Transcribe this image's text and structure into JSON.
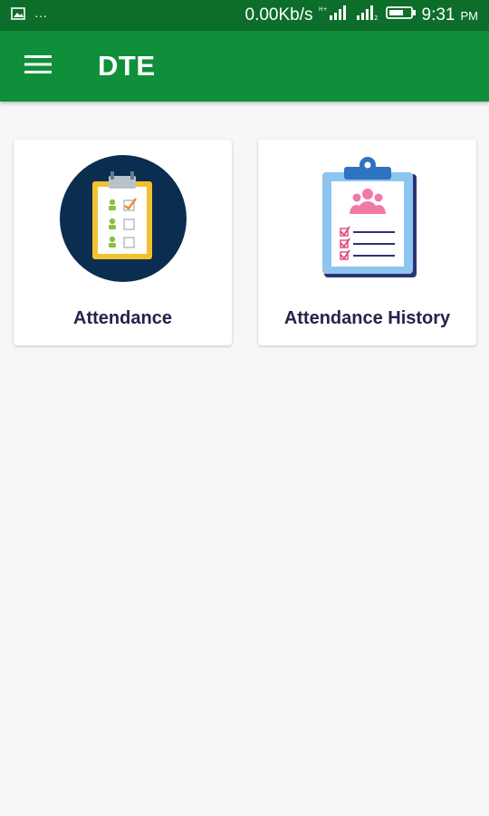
{
  "status_bar": {
    "network_speed": "0.00Kb/s",
    "time": "9:31",
    "ampm": "PM",
    "left_glyphs": "···"
  },
  "app_bar": {
    "title": "DTE",
    "menu_icon": "hamburger-menu-icon"
  },
  "cards": [
    {
      "label": "Attendance",
      "icon": "attendance-checklist-icon"
    },
    {
      "label": "Attendance History",
      "icon": "attendance-history-clipboard-icon"
    }
  ],
  "colors": {
    "status_bar": "#0d6e2b",
    "app_bar": "#0f8f3a",
    "background": "#f7f7f7",
    "card_text": "#23244a"
  }
}
